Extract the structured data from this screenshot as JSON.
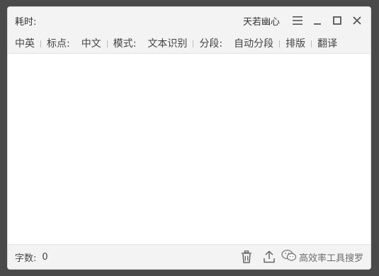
{
  "titlebar": {
    "time_label": "耗时:",
    "brand": "天若幽心"
  },
  "toolbar": {
    "items": [
      {
        "label": "中英"
      },
      {
        "label": "标点:"
      },
      {
        "label": "中文"
      },
      {
        "label": "模式:"
      },
      {
        "label": "文本识别"
      },
      {
        "label": "分段:"
      },
      {
        "label": "自动分段"
      },
      {
        "label": "排版"
      },
      {
        "label": "翻译"
      }
    ]
  },
  "status": {
    "char_count_label": "字数:",
    "char_count_value": "0"
  },
  "watermark": {
    "text": "高效率工具搜罗"
  },
  "icons": {
    "menu": "menu-icon",
    "minimize": "minimize-icon",
    "maximize": "maximize-icon",
    "close": "close-icon",
    "trash": "trash-icon",
    "upload": "upload-icon",
    "wechat": "wechat-icon"
  },
  "colors": {
    "chrome": "#f3f3f3",
    "background": "#4a4a4a",
    "content": "#ffffff"
  }
}
